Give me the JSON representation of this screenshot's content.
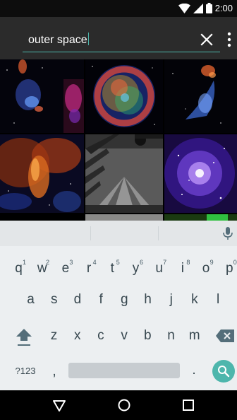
{
  "status_bar": {
    "time": "2:00",
    "icons": [
      "wifi-icon",
      "cell-signal-icon",
      "battery-icon"
    ]
  },
  "search": {
    "query": "outer space",
    "clear_icon": "close-icon",
    "menu_icon": "more-vert-icon",
    "accent": "#4db6ac"
  },
  "results": {
    "images": [
      {
        "name": "blue-nebula-image"
      },
      {
        "name": "supernova-remnant-image"
      },
      {
        "name": "blue-jet-image"
      },
      {
        "name": "orange-nebula-image"
      },
      {
        "name": "black-white-space-photo"
      },
      {
        "name": "purple-galaxy-cluster-image"
      }
    ]
  },
  "keyboard": {
    "row1": [
      {
        "label": "q",
        "hint": "1"
      },
      {
        "label": "w",
        "hint": "2"
      },
      {
        "label": "e",
        "hint": "3"
      },
      {
        "label": "r",
        "hint": "4"
      },
      {
        "label": "t",
        "hint": "5"
      },
      {
        "label": "y",
        "hint": "6"
      },
      {
        "label": "u",
        "hint": "7"
      },
      {
        "label": "i",
        "hint": "8"
      },
      {
        "label": "o",
        "hint": "9"
      },
      {
        "label": "p",
        "hint": "0"
      }
    ],
    "row2": [
      "a",
      "s",
      "d",
      "f",
      "g",
      "h",
      "j",
      "k",
      "l"
    ],
    "row3": [
      "z",
      "x",
      "c",
      "v",
      "b",
      "n",
      "m"
    ],
    "symbols_label": "?123",
    "comma_label": ",",
    "period_label": ".",
    "shift_icon": "shift-icon",
    "backspace_icon": "backspace-icon",
    "search_icon": "search-icon",
    "mic_icon": "mic-icon"
  },
  "nav_bar": {
    "icons": [
      "back-icon",
      "home-icon",
      "recents-icon"
    ]
  }
}
